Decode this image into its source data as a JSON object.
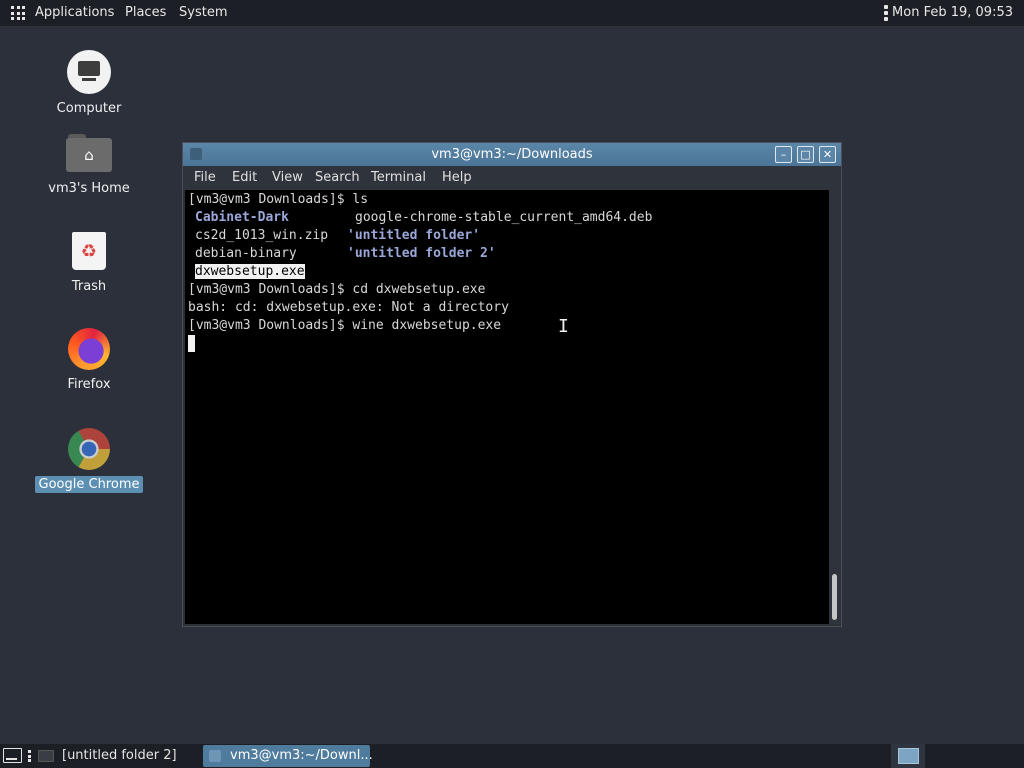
{
  "top_panel": {
    "applications": "Applications",
    "places": "Places",
    "system": "System",
    "datetime": "Mon Feb 19, 09:53"
  },
  "desktop": {
    "icons": [
      {
        "label": "Computer"
      },
      {
        "label": "vm3's Home"
      },
      {
        "label": "Trash"
      },
      {
        "label": "Firefox"
      },
      {
        "label": "Google Chrome"
      }
    ]
  },
  "terminal": {
    "title": "vm3@vm3:~/Downloads",
    "window_buttons": {
      "minimize": "–",
      "maximize": "□",
      "close": "✕"
    },
    "menu": [
      "File",
      "Edit",
      "View",
      "Search",
      "Terminal",
      "Help"
    ],
    "prompt": "[vm3@vm3 Downloads]$ ",
    "lines": {
      "cmd1": "ls",
      "ls_row1_col1": "Cabinet-Dark",
      "ls_row1_col2": "google-chrome-stable_current_amd64.deb",
      "ls_row2_col1": "cs2d_1013_win.zip",
      "ls_row2_col2": "'untitled folder'",
      "ls_row3_col1": "debian-binary",
      "ls_row3_col2": "'untitled folder 2'",
      "ls_row4_col1": "dxwebsetup.exe",
      "cmd2": "cd dxwebsetup.exe",
      "error": "bash: cd: dxwebsetup.exe: Not a directory",
      "cmd3": "wine dxwebsetup.exe"
    }
  },
  "taskbar": {
    "tasks": [
      {
        "label": "[untitled folder 2]"
      },
      {
        "label": "vm3@vm3:~/Downl..."
      }
    ]
  }
}
